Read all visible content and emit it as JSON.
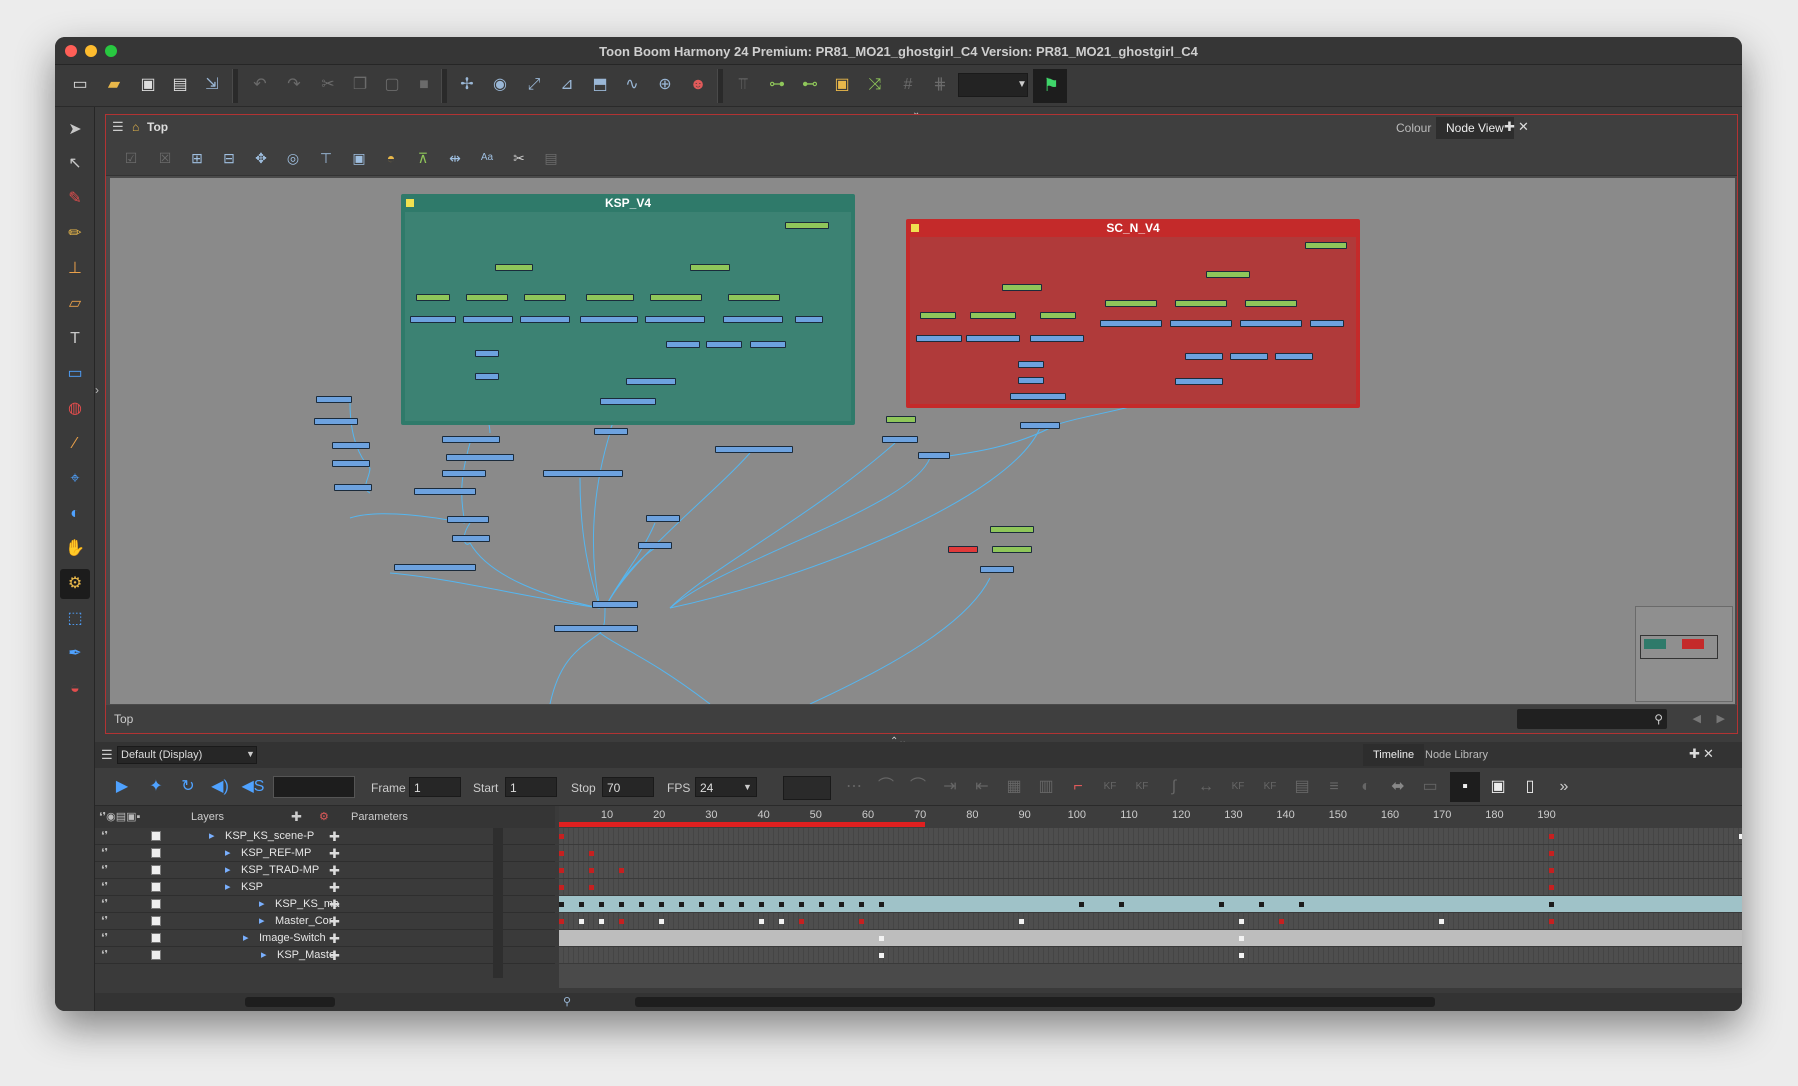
{
  "window": {
    "title": "Toon Boom Harmony 24 Premium: PR81_MO21_ghostgirl_C4 Version: PR81_MO21_ghostgirl_C4"
  },
  "node_view": {
    "breadcrumb": "Top",
    "tabs": [
      "Colour",
      "Node View"
    ],
    "footer_label": "Top",
    "backdrops": [
      {
        "title": "KSP_V4",
        "color": "#2f7a6a"
      },
      {
        "title": "SC_N_V4",
        "color": "#c42a2a"
      }
    ]
  },
  "timeline": {
    "view_mode": "Default (Display)",
    "tabs": [
      "Timeline",
      "Node Library"
    ],
    "frame_label": "Frame",
    "frame_value": "1",
    "start_label": "Start",
    "start_value": "1",
    "stop_label": "Stop",
    "stop_value": "70",
    "fps_label": "FPS",
    "fps_value": "24",
    "layers_header": "Layers",
    "parameters_header": "Parameters",
    "ruler_ticks": [
      "10",
      "20",
      "30",
      "40",
      "50",
      "60",
      "70",
      "80",
      "90",
      "100",
      "110",
      "120",
      "130",
      "140",
      "150",
      "160",
      "170",
      "180",
      "190"
    ],
    "layers": [
      {
        "name": "KSP_KS_scene-P",
        "indent": 130
      },
      {
        "name": "KSP_REF-MP",
        "indent": 146
      },
      {
        "name": "KSP_TRAD-MP",
        "indent": 146
      },
      {
        "name": "KSP",
        "indent": 146
      },
      {
        "name": "KSP_KS_ma",
        "indent": 180
      },
      {
        "name": "Master_Cor",
        "indent": 180
      },
      {
        "name": "Image-Switch",
        "indent": 164
      },
      {
        "name": "KSP_Maste",
        "indent": 182
      }
    ]
  }
}
